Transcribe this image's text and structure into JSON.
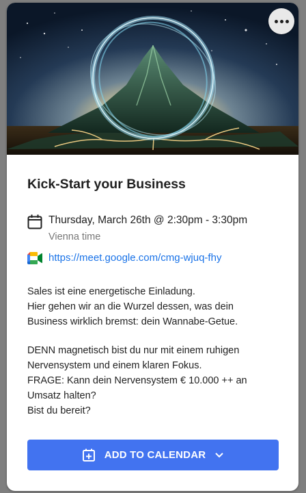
{
  "event": {
    "title": "Kick-Start your Business",
    "datetime": "Thursday, March 26th @ 2:30pm - 3:30pm",
    "timezone": "Vienna time",
    "meet_link": "https://meet.google.com/cmg-wjuq-fhy",
    "description_p1": [
      "Sales ist eine energetische Einladung.",
      "Hier gehen wir an die Wurzel dessen, was dein",
      "Business wirklich bremst: dein Wannabe-Getue."
    ],
    "description_p2": [
      "DENN magnetisch bist du nur mit einem ruhigen",
      "Nervensystem und einem klaren Fokus.",
      "FRAGE: Kann dein Nervensystem € 10.000 ++ an",
      "Umsatz halten?",
      "Bist du bereit?"
    ]
  },
  "actions": {
    "add_to_calendar": "ADD TO CALENDAR"
  },
  "icons": {
    "more": "more-horizontal-icon",
    "calendar": "calendar-icon",
    "meet": "google-meet-icon",
    "calendar_add": "calendar-add-icon",
    "dropdown": "chevron-down-icon"
  },
  "colors": {
    "primary_button": "#4273f0",
    "link": "#1a73e8",
    "backdrop": "#7f7f7f"
  }
}
